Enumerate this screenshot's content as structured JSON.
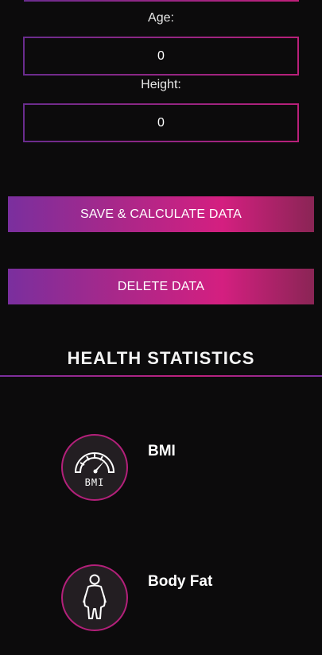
{
  "form": {
    "age_label": "Age:",
    "age_value": "0",
    "height_label": "Height:",
    "height_value": "0"
  },
  "buttons": {
    "save_label": "SAVE & CALCULATE DATA",
    "delete_label": "DELETE DATA"
  },
  "health": {
    "title": "HEALTH STATISTICS",
    "stats": [
      {
        "label": "BMI",
        "icon": "bmi-gauge-icon",
        "icon_text": "BMI"
      },
      {
        "label": "Body Fat",
        "icon": "body-figure-icon"
      }
    ]
  },
  "colors": {
    "accent_purple": "#7a2f9e",
    "accent_pink": "#d41f80",
    "background": "#0c0b0c"
  }
}
